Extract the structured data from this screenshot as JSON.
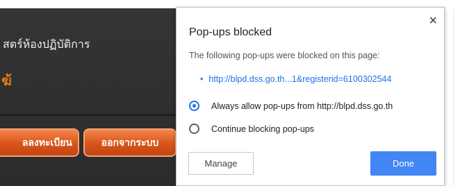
{
  "site": {
    "header_text": "สตร์ห้องปฏิบัติการ",
    "orange_glyph": "ฆ้",
    "register_button": "ลลงทะเบียน",
    "logout_button": "ออกจากระบบ"
  },
  "popup": {
    "title": "Pop-ups blocked",
    "description": "The following pop-ups were blocked on this page:",
    "blocked_link": "http://blpd.dss.go.th...1&registerid=6100302544",
    "options": [
      {
        "label": "Always allow pop-ups from http://blpd.dss.go.th",
        "selected": true
      },
      {
        "label": "Continue blocking pop-ups",
        "selected": false
      }
    ],
    "manage_label": "Manage",
    "done_label": "Done",
    "close_glyph": "×"
  },
  "colors": {
    "accent": "#1a73e8",
    "done_button": "#4285f4",
    "site_button": "#d8541a",
    "site_background": "#2e2e2e"
  }
}
